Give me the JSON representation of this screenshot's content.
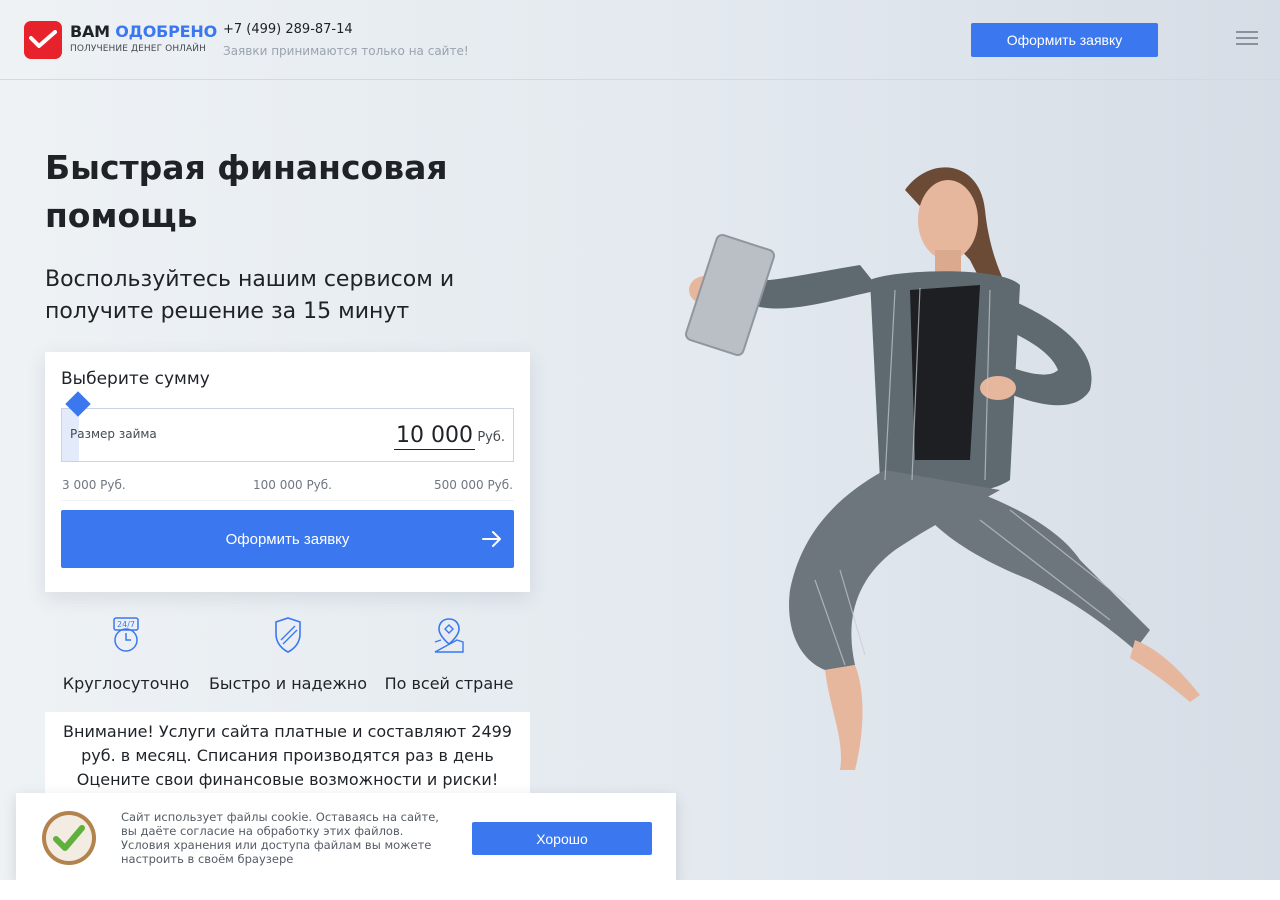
{
  "header": {
    "logo_word_1": "ВАМ",
    "logo_word_2": "ОДОБРЕНО",
    "logo_tagline": "получение денег онлайн",
    "phone": "+7 (499) 289-87-14",
    "phone_note": "Заявки принимаются только на сайте!",
    "apply_label": "Оформить заявку"
  },
  "hero": {
    "title": "Быстрая финансовая помощь",
    "subtitle": "Воспользуйтесь нашим сервисом и получите решение за 15 минут"
  },
  "calculator": {
    "title": "Выберите сумму",
    "amount_label": "Размер займа",
    "amount_value": "10 000",
    "amount_unit": "Руб.",
    "slider_fraction": 0.015,
    "scale_min": "3 000 Руб.",
    "scale_mid": "100 000 Руб.",
    "scale_max": "500 000 Руб.",
    "submit_label": "Оформить заявку"
  },
  "features": [
    {
      "icon": "clock-24-7-icon",
      "label": "Круглосуточно"
    },
    {
      "icon": "shield-icon",
      "label": "Быстро и надежно"
    },
    {
      "icon": "map-pin-icon",
      "label": "По всей стране"
    }
  ],
  "notice": {
    "text": "Внимание! Услуги сайта платные и составляют 2499 руб. в месяц. Списания производятся раз в день Оцените свои финансовые возможности и риски!"
  },
  "cookie": {
    "text": "Сайт использует файлы cookie. Оставаясь на сайте, вы даёте согласие на обработку этих файлов. Условия хранения или доступа файлам вы можете настроить в своём браузере",
    "accept_label": "Хорошо"
  },
  "colors": {
    "accent": "#3b78f0",
    "brand_red": "#e8222a"
  }
}
